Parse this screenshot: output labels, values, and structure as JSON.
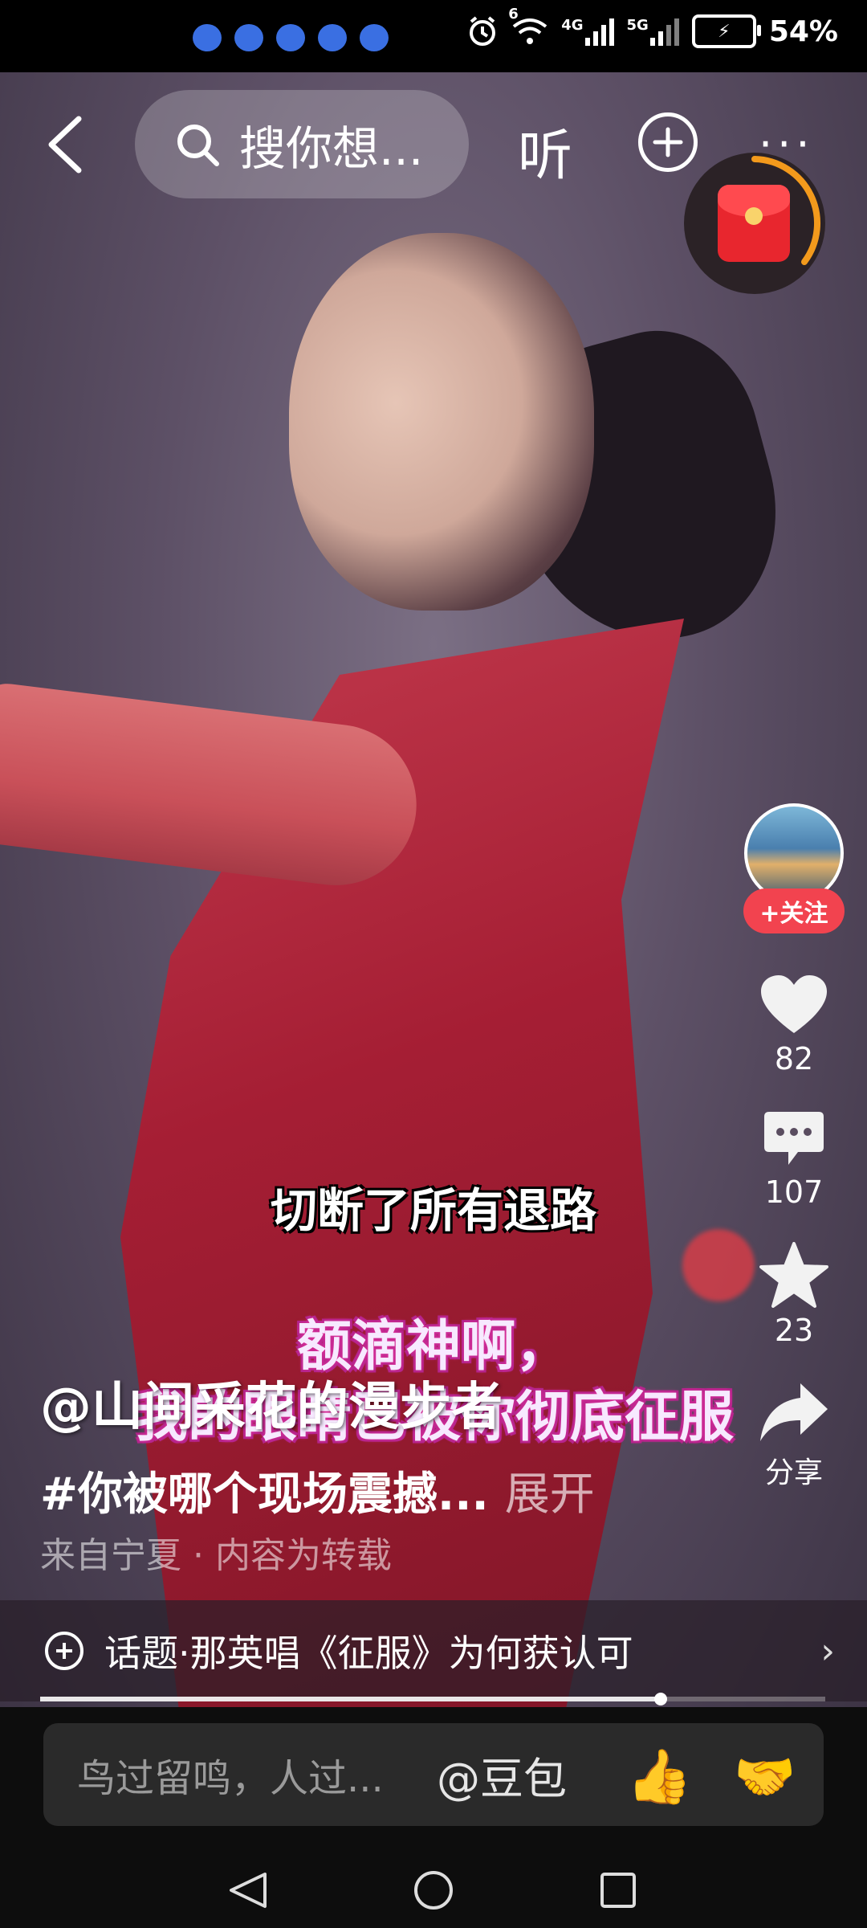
{
  "status_bar": {
    "wifi_badge": "6",
    "net1": "4G",
    "net2": "5G",
    "battery": "54%"
  },
  "top_bar": {
    "search_text": "搜你想...",
    "listen_label": "听",
    "more_label": "···"
  },
  "video": {
    "subtitle": "切断了所有退路",
    "overlay_line1": "额滴神啊，",
    "overlay_line2": "我的眼睛已被你彻底征服"
  },
  "actions": {
    "follow_label": "+关注",
    "likes": "82",
    "comments": "107",
    "favorites": "23",
    "share_label": "分享"
  },
  "post": {
    "author": "@山间采花的漫步者",
    "description": "#你被哪个现场震撼...",
    "expand_label": "展开",
    "origin": "来自宁夏 · 内容为转载"
  },
  "topic": {
    "text": "话题·那英唱《征服》为何获认可"
  },
  "playback": {
    "progress_fraction": 0.79
  },
  "comment_bar": {
    "placeholder": "鸟过留鸣，人过...",
    "mention": "@豆包",
    "emoji1": "👍",
    "emoji2": "🤝"
  },
  "colors": {
    "follow_red": "#f2434f",
    "overlay_pink": "#b0238b",
    "redpacket_ring": "#f39a1c"
  }
}
